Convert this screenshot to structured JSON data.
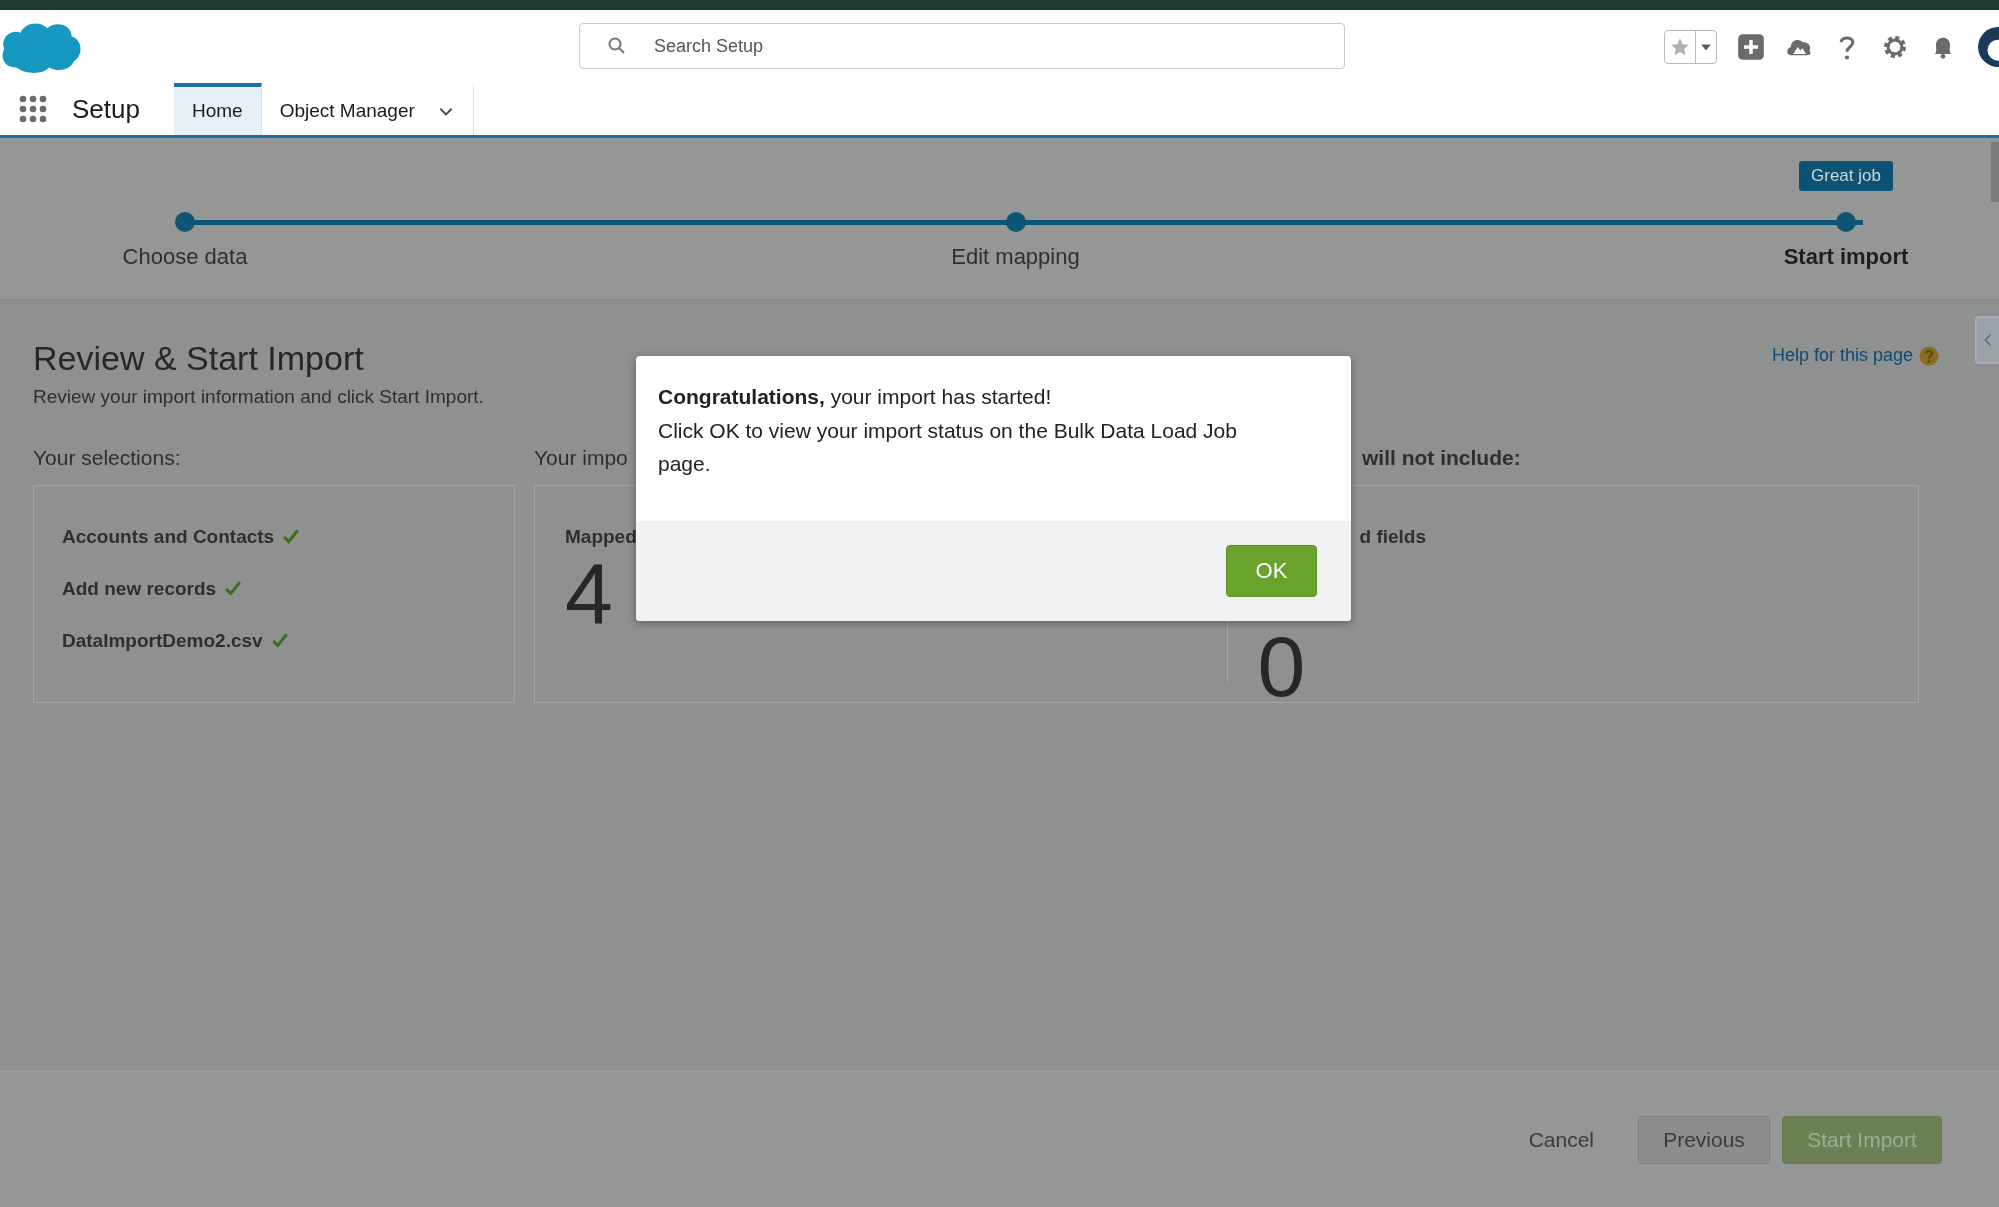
{
  "header": {
    "search": {
      "placeholder": "Search Setup"
    }
  },
  "nav": {
    "app_name": "Setup",
    "tabs": [
      {
        "label": "Home",
        "selected": true,
        "dropdown": false
      },
      {
        "label": "Object Manager",
        "selected": false,
        "dropdown": true
      }
    ]
  },
  "progress": {
    "tooltip": "Great job",
    "steps": [
      {
        "label": "Choose data",
        "current": false
      },
      {
        "label": "Edit mapping",
        "current": false
      },
      {
        "label": "Start import",
        "current": true
      }
    ]
  },
  "page": {
    "title": "Review & Start Import",
    "subtitle": "Review your import information and click Start Import.",
    "help_link": "Help for this page"
  },
  "selections": {
    "heading": "Your selections:",
    "items": [
      {
        "label": "Accounts and Contacts",
        "checked": true
      },
      {
        "label": "Add new records",
        "checked": true
      },
      {
        "label": "DataImportDemo2.csv",
        "checked": true
      }
    ]
  },
  "summary": {
    "heading": "Your impo",
    "mapped_label": "Mapped",
    "mapped_count": "4"
  },
  "excluded": {
    "heading": "will not include:",
    "label": "d fields",
    "count": "0"
  },
  "modal": {
    "message": "**Congratulations,** your import has started!",
    "detail": "Click OK to view your import status on the Bulk Data Load Job page.",
    "button": "OK"
  },
  "footer": {
    "buttons": [
      {
        "label": "Cancel",
        "kind": "link"
      },
      {
        "label": "Previous",
        "kind": "neutral"
      },
      {
        "label": "Start Import",
        "kind": "brand"
      }
    ]
  }
}
